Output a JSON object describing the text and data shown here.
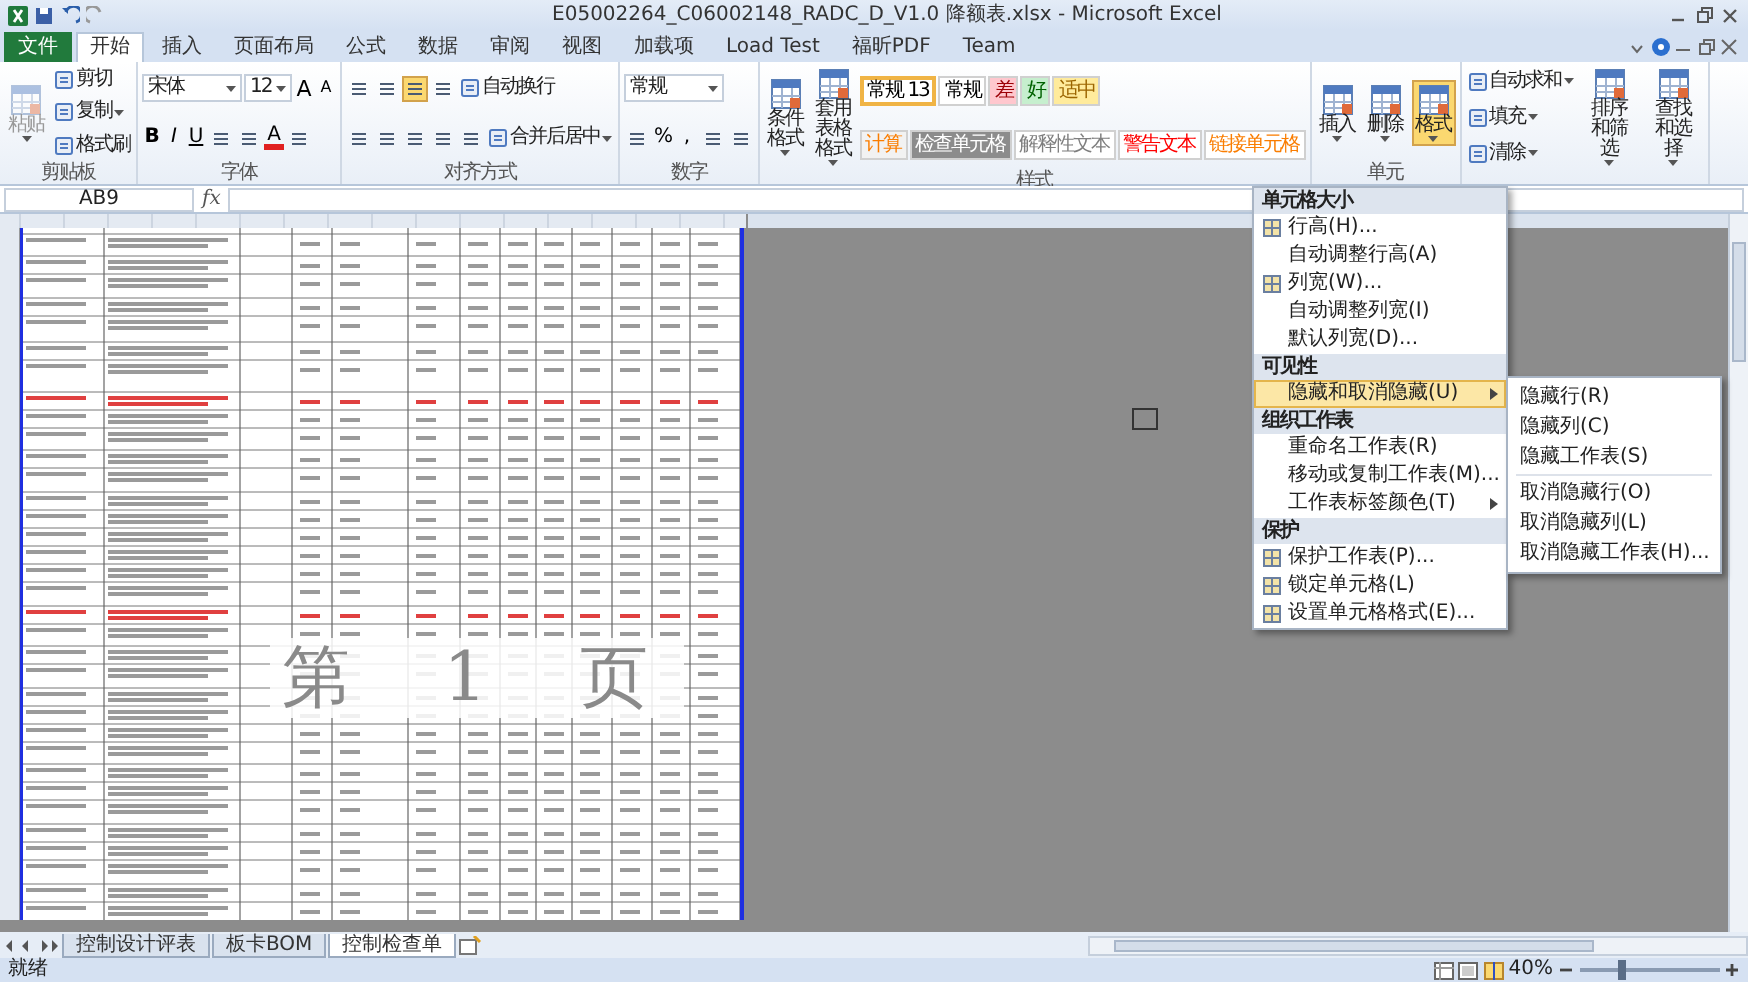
{
  "window": {
    "title": "E05002264_C06002148_RADC_D_V1.0 降额表.xlsx - Microsoft Excel"
  },
  "ribbon_tabs": [
    {
      "label": "文件",
      "kind": "file",
      "selected": false
    },
    {
      "label": "开始",
      "kind": "tab",
      "selected": true
    },
    {
      "label": "插入",
      "kind": "tab",
      "selected": false
    },
    {
      "label": "页面布局",
      "kind": "tab",
      "selected": false
    },
    {
      "label": "公式",
      "kind": "tab",
      "selected": false
    },
    {
      "label": "数据",
      "kind": "tab",
      "selected": false
    },
    {
      "label": "审阅",
      "kind": "tab",
      "selected": false
    },
    {
      "label": "视图",
      "kind": "tab",
      "selected": false
    },
    {
      "label": "加载项",
      "kind": "tab",
      "selected": false
    },
    {
      "label": "Load Test",
      "kind": "tab",
      "selected": false
    },
    {
      "label": "福昕PDF",
      "kind": "tab",
      "selected": false
    },
    {
      "label": "Team",
      "kind": "tab",
      "selected": false
    }
  ],
  "ribbon_groups": [
    {
      "label": "剪贴板",
      "columns": [
        [
          [
            {
              "kind": "large",
              "label": "粘贴",
              "disabled": true,
              "selected": false,
              "dropdown": true
            }
          ]
        ],
        [
          [
            {
              "kind": "small",
              "label": "剪切",
              "dropdown": false
            }
          ],
          [
            {
              "kind": "small",
              "label": "复制",
              "dropdown": true
            }
          ],
          [
            {
              "kind": "small",
              "label": "格式刷",
              "dropdown": false
            }
          ]
        ]
      ]
    },
    {
      "label": "字体",
      "columns": [
        [
          [
            {
              "kind": "combo",
              "value": "宋体",
              "wide": true
            },
            {
              "kind": "combo",
              "value": "12",
              "wide": false
            },
            {
              "kind": "grow",
              "label": "A"
            },
            {
              "kind": "shrink",
              "label": "A"
            }
          ],
          [
            {
              "kind": "bold",
              "label": "B"
            },
            {
              "kind": "italic",
              "label": "I"
            },
            {
              "kind": "underline",
              "label": "U"
            },
            {
              "kind": "icon",
              "selected": false
            },
            {
              "kind": "icon",
              "selected": false
            },
            {
              "kind": "font-color",
              "label": "A"
            },
            {
              "kind": "icon",
              "selected": false
            }
          ]
        ]
      ]
    },
    {
      "label": "对齐方式",
      "columns": [
        [
          [
            {
              "kind": "icon",
              "selected": false
            },
            {
              "kind": "icon",
              "selected": false
            },
            {
              "kind": "icon",
              "selected": true
            },
            {
              "kind": "icon",
              "selected": false
            },
            {
              "kind": "small",
              "label": "自动换行",
              "dropdown": false
            }
          ],
          [
            {
              "kind": "icon",
              "selected": false
            },
            {
              "kind": "icon",
              "selected": false
            },
            {
              "kind": "icon",
              "selected": false
            },
            {
              "kind": "icon",
              "selected": false
            },
            {
              "kind": "icon",
              "selected": false
            },
            {
              "kind": "small",
              "label": "合并后居中",
              "dropdown": true
            }
          ]
        ]
      ]
    },
    {
      "label": "数字",
      "columns": [
        [
          [
            {
              "kind": "combo",
              "value": "常规",
              "wide": true
            }
          ],
          [
            {
              "kind": "icon",
              "selected": false
            },
            {
              "kind": "text",
              "label": "%"
            },
            {
              "kind": "text",
              "label": ","
            },
            {
              "kind": "icon",
              "selected": false
            },
            {
              "kind": "icon",
              "selected": false
            }
          ]
        ]
      ]
    },
    {
      "label": "样式",
      "columns": [
        [
          [
            {
              "kind": "large",
              "label": "条件格式",
              "disabled": false,
              "selected": false,
              "dropdown": true
            }
          ]
        ],
        [
          [
            {
              "kind": "large",
              "label": "套用表格格式",
              "disabled": false,
              "selected": false,
              "dropdown": true
            }
          ]
        ],
        [
          [
            {
              "kind": "style",
              "label": "常规 13",
              "color": "#ffffff",
              "selected": true
            },
            {
              "kind": "style",
              "label": "常规",
              "color": "#ffffff",
              "selected": false
            },
            {
              "kind": "style",
              "label": "差",
              "color": "#ffc7ce",
              "selected": false
            },
            {
              "kind": "style",
              "label": "好",
              "color": "#c6efce",
              "selected": false
            },
            {
              "kind": "style",
              "label": "适中",
              "color": "#ffeb9c",
              "selected": false
            }
          ],
          [
            {
              "kind": "style",
              "label": "计算",
              "color": "#f2f2f2",
              "selected": false
            },
            {
              "kind": "style",
              "label": "检查单元格",
              "color": "#8c8c8c",
              "selected": false
            },
            {
              "kind": "style",
              "label": "解释性文本",
              "color": "#ffffff",
              "selected": false
            },
            {
              "kind": "style",
              "label": "警告文本",
              "color": "#ffffff",
              "selected": false
            },
            {
              "kind": "style",
              "label": "链接单元格",
              "color": "#ffffff",
              "selected": false
            }
          ]
        ]
      ]
    },
    {
      "label": "单元",
      "columns": [
        [
          [
            {
              "kind": "large",
              "label": "插入",
              "disabled": false,
              "selected": false,
              "dropdown": true
            }
          ]
        ],
        [
          [
            {
              "kind": "large",
              "label": "删除",
              "disabled": false,
              "selected": false,
              "dropdown": true
            }
          ]
        ],
        [
          [
            {
              "kind": "large",
              "label": "格式",
              "disabled": false,
              "selected": true,
              "dropdown": true
            }
          ]
        ]
      ]
    },
    {
      "columns": [
        [
          [
            {
              "kind": "small",
              "label": "自动求和",
              "dropdown": true
            }
          ],
          [
            {
              "kind": "small",
              "label": "填充",
              "dropdown": true
            }
          ],
          [
            {
              "kind": "small",
              "label": "清除",
              "dropdown": true
            }
          ]
        ],
        [
          [
            {
              "kind": "large",
              "label": "排序和筛选",
              "disabled": false,
              "selected": false,
              "dropdown": true
            }
          ]
        ],
        [
          [
            {
              "kind": "large",
              "label": "查找和选择",
              "disabled": false,
              "selected": false,
              "dropdown": true
            }
          ]
        ]
      ]
    }
  ],
  "formula_bar": {
    "name_box": "AB9",
    "function_label": "fx"
  },
  "format_menu": {
    "items": [
      {
        "kind": "header",
        "label": "单元格大小"
      },
      {
        "kind": "item",
        "label": "行高(H)...",
        "icon": true,
        "selected": false
      },
      {
        "kind": "item",
        "label": "自动调整行高(A)",
        "icon": false,
        "selected": false
      },
      {
        "kind": "item",
        "label": "列宽(W)...",
        "icon": true,
        "selected": false
      },
      {
        "kind": "item",
        "label": "自动调整列宽(I)",
        "icon": false,
        "selected": false
      },
      {
        "kind": "item",
        "label": "默认列宽(D)...",
        "icon": false,
        "selected": false
      },
      {
        "kind": "header",
        "label": "可见性"
      },
      {
        "kind": "submenu",
        "label": "隐藏和取消隐藏(U)",
        "icon": false,
        "selected": true
      },
      {
        "kind": "header",
        "label": "组织工作表"
      },
      {
        "kind": "item",
        "label": "重命名工作表(R)",
        "icon": false,
        "selected": false
      },
      {
        "kind": "item",
        "label": "移动或复制工作表(M)...",
        "icon": false,
        "selected": false
      },
      {
        "kind": "submenu",
        "label": "工作表标签颜色(T)",
        "icon": false,
        "selected": false
      },
      {
        "kind": "header",
        "label": "保护"
      },
      {
        "kind": "item",
        "label": "保护工作表(P)...",
        "icon": true,
        "selected": false
      },
      {
        "kind": "item",
        "label": "锁定单元格(L)",
        "icon": true,
        "selected": false
      },
      {
        "kind": "item",
        "label": "设置单元格格式(E)...",
        "icon": true,
        "selected": false
      }
    ],
    "submenu": [
      {
        "label": "隐藏行(R)"
      },
      {
        "label": "隐藏列(C)"
      },
      {
        "label": "隐藏工作表(S)"
      },
      {
        "label": "取消隐藏行(O)"
      },
      {
        "label": "取消隐藏列(L)"
      },
      {
        "label": "取消隐藏工作表(H)..."
      }
    ]
  },
  "page_label": "第 1 页",
  "sheet_tabs": [
    {
      "label": "控制设计评表",
      "selected": false
    },
    {
      "label": "板卡BOM",
      "selected": false
    },
    {
      "label": "控制检查单",
      "selected": true
    }
  ],
  "status_bar": {
    "text": "就绪",
    "zoom": "40%",
    "zoom_slider": {
      "level": 0.3
    }
  }
}
